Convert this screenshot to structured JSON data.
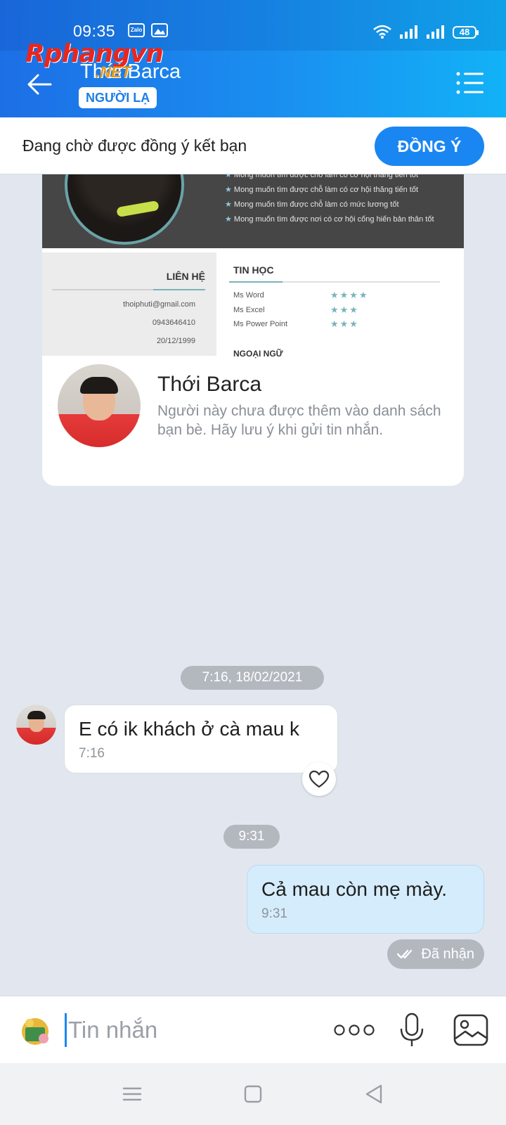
{
  "status_bar": {
    "time": "09:35",
    "app_icons": [
      "Zalo",
      "image-notification-icon"
    ],
    "battery": "48"
  },
  "watermark": {
    "line1": "Rphangvn",
    "line2": ".NET"
  },
  "header": {
    "title": "Thới Barca",
    "badge": "NGƯỜI LẠ"
  },
  "friend_request": {
    "text": "Đang chờ được đồng ý kết bạn",
    "button": "ĐỒNG Ý"
  },
  "profile_card": {
    "cover": {
      "goals": [
        "Mong muốn tìm được chỗ làm có cơ hội thăng tiến tốt",
        "Mong muốn tìm được chỗ làm có cơ hội thăng tiến tốt",
        "Mong muốn tìm được chỗ làm có mức lương tốt",
        "Mong muốn tìm được nơi có cơ hội cống hiến bản thân tốt"
      ],
      "contact_heading": "LIÊN HỆ",
      "contacts": [
        "thoiphuti@gmail.com",
        "0943646410",
        "20/12/1999"
      ],
      "skills_heading": "TIN HỌC",
      "skills": [
        {
          "name": "Ms Word",
          "stars": "★★★★"
        },
        {
          "name": "Ms Excel",
          "stars": "★★★"
        },
        {
          "name": "Ms Power Point",
          "stars": "★★★"
        }
      ],
      "next_heading": "NGOẠI NGỮ"
    },
    "name": "Thới Barca",
    "note": "Người này chưa được thêm vào danh sách bạn bè. Hãy lưu ý khi gửi tin nhắn."
  },
  "messages": {
    "date_pill_1": "7:16, 18/02/2021",
    "incoming": {
      "text": "E có ik khách ở cà mau k",
      "time": "7:16"
    },
    "date_pill_2": "9:31",
    "outgoing": {
      "text": "Cả mau còn mẹ mày.",
      "time": "9:31"
    },
    "status": "Đã nhận"
  },
  "composer": {
    "placeholder": "Tin nhắn"
  },
  "colors": {
    "accent": "#1a86f2",
    "header_start": "#1d6fe6",
    "header_end": "#12b2f7",
    "chat_bg": "#e2e7ef"
  }
}
